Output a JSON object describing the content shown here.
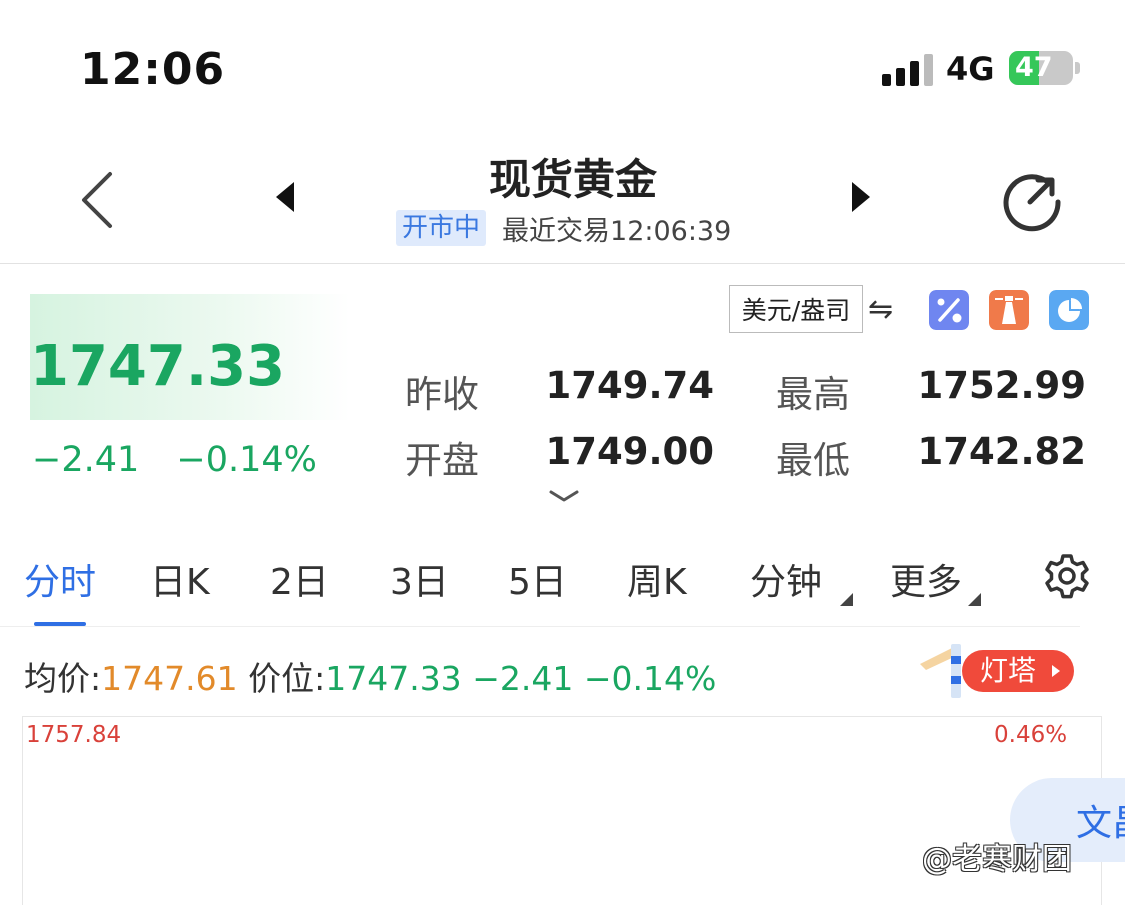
{
  "status_bar": {
    "time": "12:06",
    "network": "4G",
    "battery": "47",
    "battery_level": 0.47
  },
  "header": {
    "title": "现货黄金",
    "market_status": "开市中",
    "last_trade": "最近交易12:06:39"
  },
  "quote": {
    "price": "1747.33",
    "change": "−2.41",
    "change_pct": "−0.14%",
    "unit": "美元/盎司",
    "swap_symbol": "⇋",
    "stats": [
      {
        "label": "昨收",
        "value": "1749.74"
      },
      {
        "label": "最高",
        "value": "1752.99"
      },
      {
        "label": "开盘",
        "value": "1749.00"
      },
      {
        "label": "最低",
        "value": "1742.82"
      }
    ],
    "colors": {
      "down": "#1aa661",
      "up": "#d9413a"
    }
  },
  "tabs": [
    {
      "label": "分时",
      "active": true
    },
    {
      "label": "日K"
    },
    {
      "label": "2日"
    },
    {
      "label": "3日"
    },
    {
      "label": "5日"
    },
    {
      "label": "周K"
    },
    {
      "label": "分钟",
      "dropdown": true
    },
    {
      "label": "更多",
      "dropdown": true
    }
  ],
  "info_row": {
    "avg_label": "均价:",
    "avg_value": "1747.61",
    "level_label": "价位:",
    "level_value": "1747.33",
    "change": "−2.41",
    "change_pct": "−0.14%"
  },
  "beacon": {
    "label": "灯塔"
  },
  "chart": {
    "y_max": "1757.84",
    "pct_max": "0.46%"
  },
  "floating_button": {
    "label": "文昌"
  },
  "watermark": "@老寒财团",
  "icons": {
    "back": "chevron-left-icon",
    "prev": "triangle-left-icon",
    "next": "triangle-right-icon",
    "refresh": "refresh-icon",
    "percent": "percent-icon",
    "tower": "lighthouse-icon",
    "pie": "pie-chart-icon",
    "settings": "gear-icon"
  }
}
